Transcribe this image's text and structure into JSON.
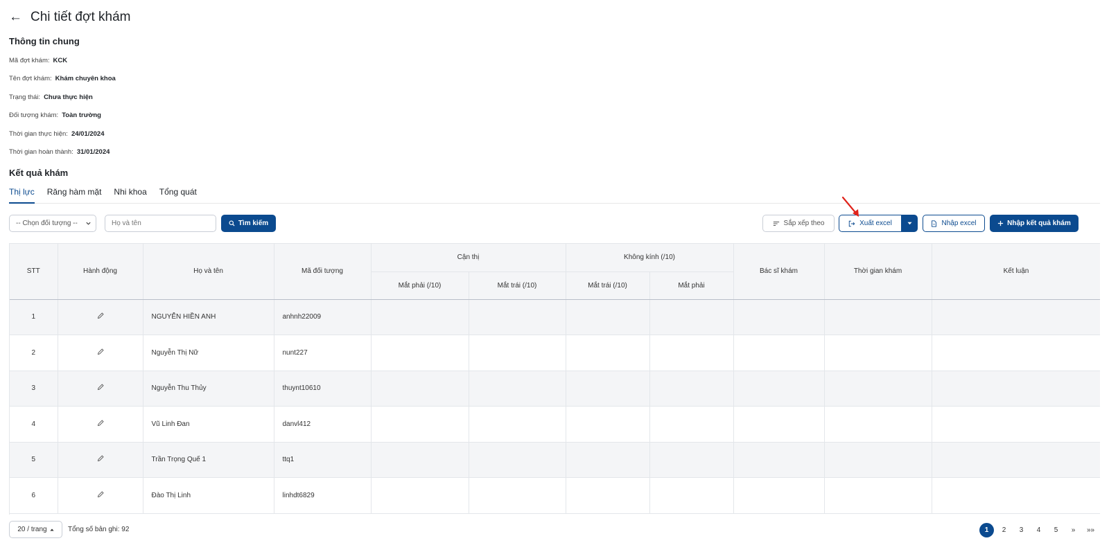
{
  "header": {
    "back_icon": "←",
    "title": "Chi tiết đợt khám"
  },
  "general": {
    "title": "Thông tin chung",
    "fields": [
      {
        "label": "Mã đợt khám:",
        "value": "KCK"
      },
      {
        "label": "Tên đợt khám:",
        "value": "Khám chuyên khoa"
      },
      {
        "label": "Trạng thái:",
        "value": "Chưa thực hiện"
      },
      {
        "label": "Đối tượng khám:",
        "value": "Toàn trường"
      },
      {
        "label": "Thời gian thực hiện:",
        "value": "24/01/2024"
      },
      {
        "label": "Thời gian hoàn thành:",
        "value": "31/01/2024"
      }
    ]
  },
  "results": {
    "title": "Kết quả khám",
    "tabs": [
      "Thị lực",
      "Răng hàm mặt",
      "Nhi khoa",
      "Tổng quát"
    ],
    "active_tab": "Thị lực"
  },
  "toolbar": {
    "select_value": "-- Chọn đối tượng --",
    "name_placeholder": "Họ và tên",
    "search_label": "Tìm kiếm",
    "sort_label": "Sắp xếp theo",
    "export_label": "Xuất excel",
    "import_label": "Nhập excel",
    "add_result_label": "Nhập kết quả khám"
  },
  "table": {
    "headers": {
      "stt": "STT",
      "action": "Hành động",
      "name": "Họ và tên",
      "code": "Mã đối tượng",
      "can_thi": "Cận thị",
      "khong_kinh": "Không kính (/10)",
      "right_eye": "Mắt phải (/10)",
      "left_eye": "Mắt trái (/10)",
      "nk_left": "Mắt trái (/10)",
      "nk_right": "Mắt phải",
      "doctor": "Bác sĩ khám",
      "time": "Thời gian khám",
      "conclusion": "Kết luận"
    },
    "rows": [
      {
        "stt": "1",
        "name": "NGUYỄN HIỀN ANH",
        "code": "anhnh22009"
      },
      {
        "stt": "2",
        "name": "Nguyễn Thị Nữ",
        "code": "nunt227"
      },
      {
        "stt": "3",
        "name": "Nguyễn Thu Thủy",
        "code": "thuynt10610"
      },
      {
        "stt": "4",
        "name": "Vũ Linh Đan",
        "code": "danvl412"
      },
      {
        "stt": "5",
        "name": "Trần Trọng Quế 1",
        "code": "ttq1"
      },
      {
        "stt": "6",
        "name": "Đào Thị Linh",
        "code": "linhdt6829"
      }
    ]
  },
  "footer": {
    "page_size": "20 / trang",
    "total": "Tổng số bản ghi: 92",
    "pages": [
      "1",
      "2",
      "3",
      "4",
      "5"
    ],
    "current_page": "1",
    "next": "»",
    "last": "»»"
  },
  "colors": {
    "primary": "#0b4a8f",
    "annotation_arrow": "#e0231b"
  }
}
